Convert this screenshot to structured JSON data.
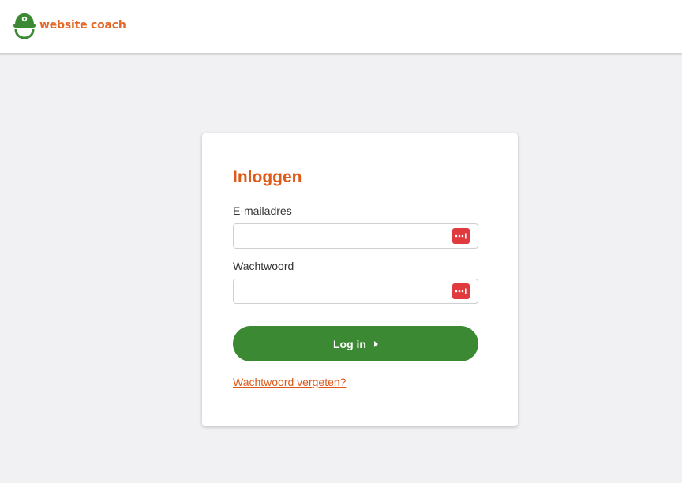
{
  "header": {
    "logo_text": "website coach",
    "logo_icon": "coach-cap-icon"
  },
  "login": {
    "title": "Inloggen",
    "email_label": "E-mailadres",
    "email_value": "",
    "password_label": "Wachtwoord",
    "password_value": "",
    "password_manager_icon": "password-manager-icon",
    "submit_label": "Log in",
    "forgot_link": "Wachtwoord vergeten?"
  },
  "colors": {
    "accent_orange": "#de5a1a",
    "button_green": "#3b8a33",
    "page_background": "#f1f1f3",
    "password_manager_red": "#e0393e"
  }
}
